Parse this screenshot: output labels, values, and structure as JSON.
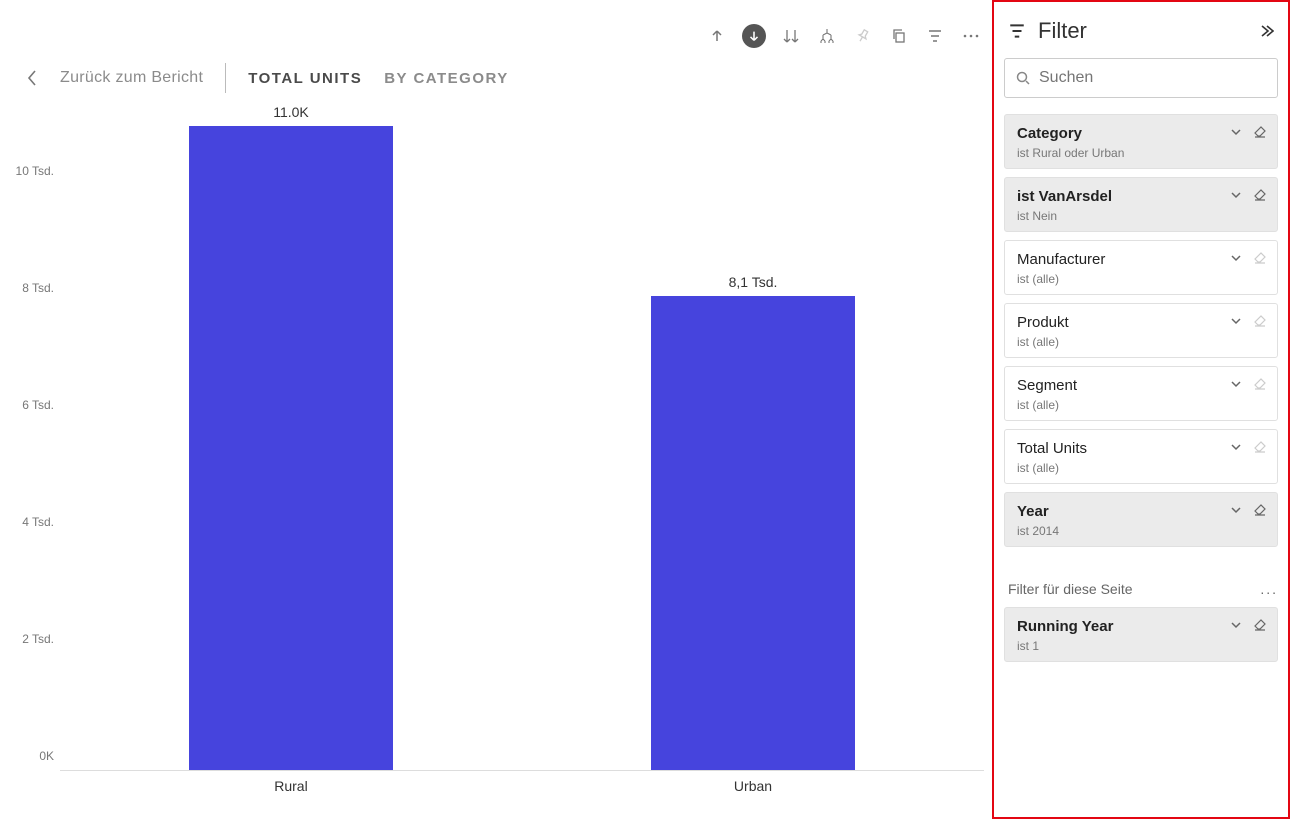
{
  "toolbar": {
    "icons": [
      "drill-up",
      "drill-down-enabled",
      "expand-all",
      "hierarchy",
      "pin",
      "copy",
      "filter",
      "more"
    ]
  },
  "breadcrumb": {
    "back": "Zurück zum Bericht",
    "tabs": [
      "TOTAL UNITS",
      "BY CATEGORY"
    ],
    "active_tab": 0
  },
  "chart_data": {
    "type": "bar",
    "categories": [
      "Rural",
      "Urban"
    ],
    "values": [
      11000,
      8100
    ],
    "value_labels": [
      "11.0K",
      "8,1 Tsd."
    ],
    "ylim": [
      0,
      11000
    ],
    "y_ticks": [
      {
        "v": 0,
        "label": "0K"
      },
      {
        "v": 2000,
        "label": "2 Tsd."
      },
      {
        "v": 4000,
        "label": "4 Tsd."
      },
      {
        "v": 6000,
        "label": "6 Tsd."
      },
      {
        "v": 8000,
        "label": "8 Tsd."
      },
      {
        "v": 10000,
        "label": "10 Tsd."
      }
    ],
    "bar_color": "#4644dd"
  },
  "filter_panel": {
    "title": "Filter",
    "search_placeholder": "Suchen",
    "cards": [
      {
        "title": "Category",
        "sub": "ist Rural oder Urban",
        "applied": true,
        "canClear": true
      },
      {
        "title": "ist VanArsdel",
        "sub": "ist Nein",
        "applied": true,
        "canClear": true
      },
      {
        "title": "Manufacturer",
        "sub": "ist (alle)",
        "applied": false,
        "canClear": false
      },
      {
        "title": "Produkt",
        "sub": "ist (alle)",
        "applied": false,
        "canClear": false
      },
      {
        "title": "Segment",
        "sub": "ist (alle)",
        "applied": false,
        "canClear": false
      },
      {
        "title": "Total Units",
        "sub": "ist (alle)",
        "applied": false,
        "canClear": false
      },
      {
        "title": "Year",
        "sub": "ist 2014",
        "applied": true,
        "canClear": true
      }
    ],
    "section_label": "Filter für diese Seite",
    "page_cards": [
      {
        "title": "Running Year",
        "sub": "ist 1",
        "applied": true,
        "canClear": true
      }
    ]
  }
}
